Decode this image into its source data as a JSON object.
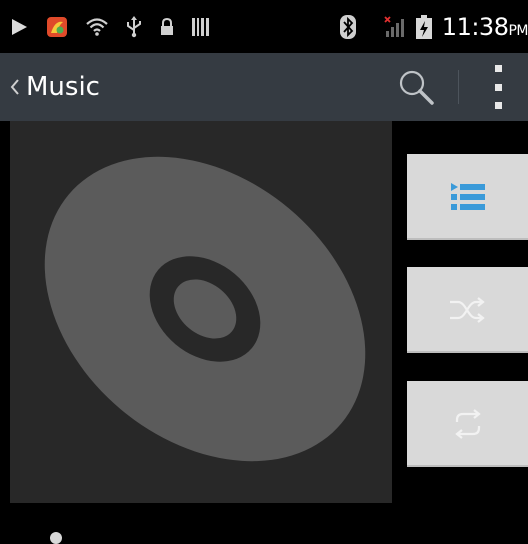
{
  "status_bar": {
    "time": "11:38",
    "ampm": "PM"
  },
  "action_bar": {
    "title": "Music"
  },
  "colors": {
    "status_bar_bg": "#000000",
    "action_bar_bg": "#353b42",
    "art_bg": "#282828",
    "disc": "#5b5b5b",
    "button_bg": "#d9d9d9",
    "playlist_icon": "#3a9ad9"
  },
  "icons": {
    "back": "chevron-left-icon",
    "search": "search-icon",
    "overflow": "overflow-menu-icon",
    "album_art": "disc-icon",
    "now_playing": "playlist-icon",
    "shuffle": "shuffle-icon",
    "repeat": "repeat-icon"
  }
}
